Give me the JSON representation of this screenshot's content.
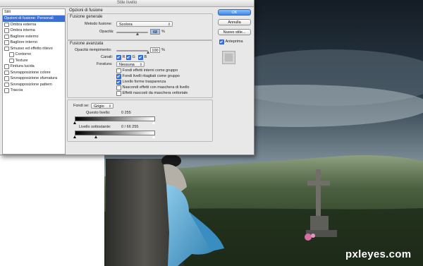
{
  "dialog": {
    "title": "Stile livello"
  },
  "styles_panel": {
    "header": "Stili",
    "items": [
      {
        "label": "Opzioni di fusione: Personali",
        "selected": true,
        "has_checkbox": false,
        "checked": false,
        "indent": false
      },
      {
        "label": "Ombra esterna",
        "selected": false,
        "has_checkbox": true,
        "checked": false,
        "indent": false
      },
      {
        "label": "Ombra interna",
        "selected": false,
        "has_checkbox": true,
        "checked": false,
        "indent": false
      },
      {
        "label": "Bagliore esterno",
        "selected": false,
        "has_checkbox": true,
        "checked": false,
        "indent": false
      },
      {
        "label": "Bagliore interno",
        "selected": false,
        "has_checkbox": true,
        "checked": false,
        "indent": false
      },
      {
        "label": "Smusso ed effetto rilievo",
        "selected": false,
        "has_checkbox": true,
        "checked": false,
        "indent": false
      },
      {
        "label": "Contorno",
        "selected": false,
        "has_checkbox": true,
        "checked": false,
        "indent": true
      },
      {
        "label": "Texture",
        "selected": false,
        "has_checkbox": true,
        "checked": false,
        "indent": true
      },
      {
        "label": "Finitura lucida",
        "selected": false,
        "has_checkbox": true,
        "checked": false,
        "indent": false
      },
      {
        "label": "Sovrapposizione colore",
        "selected": false,
        "has_checkbox": true,
        "checked": false,
        "indent": false
      },
      {
        "label": "Sovrapposizione sfumatura",
        "selected": false,
        "has_checkbox": true,
        "checked": false,
        "indent": false
      },
      {
        "label": "Sovrapposizione pattern",
        "selected": false,
        "has_checkbox": true,
        "checked": false,
        "indent": false
      },
      {
        "label": "Traccia",
        "selected": false,
        "has_checkbox": true,
        "checked": false,
        "indent": false
      }
    ]
  },
  "blending": {
    "section_title": "Opzioni di fusione",
    "general": {
      "title": "Fusione generale",
      "mode_label": "Metodo fusione:",
      "mode_value": "Scolora",
      "opacity_label": "Opacità:",
      "opacity_value": "68",
      "opacity_fraction": 0.68,
      "opacity_unit": "%"
    },
    "advanced": {
      "title": "Fusione avanzata",
      "fill_label": "Opacità riempimento:",
      "fill_value": "100",
      "fill_fraction": 1.0,
      "fill_unit": "%",
      "channels_label": "Canali:",
      "channels": [
        {
          "label": "R",
          "checked": true
        },
        {
          "label": "G",
          "checked": true
        },
        {
          "label": "B",
          "checked": true
        }
      ],
      "knockout_label": "Foratura:",
      "knockout_value": "Nessuna",
      "options": [
        {
          "label": "Fondi effetti interni come gruppo",
          "checked": false
        },
        {
          "label": "Fondi livelli ritagliati come gruppo",
          "checked": true
        },
        {
          "label": "Livello forme trasparenza",
          "checked": true
        },
        {
          "label": "Nascondi effetti con maschera di livello",
          "checked": false
        },
        {
          "label": "Effetti nascosti da maschera vettoriale",
          "checked": false
        }
      ]
    },
    "blend_if": {
      "label": "Fondi se:",
      "value": "Grigio",
      "this_layer_label": "Questo livello:",
      "this_layer_values": "0          255",
      "underlying_label": "Livello sottostante:",
      "underlying_values": "0  /  66     255"
    }
  },
  "buttons": {
    "ok": "OK",
    "cancel": "Annulla",
    "new_style": "Nuovo stile...",
    "preview_label": "Anteprima",
    "preview_checked": true
  },
  "watermark": "pxleyes.com",
  "colors": {
    "selection_blue": "#3b6fd6",
    "ok_button": "#3a88ee",
    "dialog_bg": "#e8e8e8",
    "sky_dark": "#1e2b36",
    "grass": "#2d4227",
    "dress_blue": "#5aa6cf"
  }
}
